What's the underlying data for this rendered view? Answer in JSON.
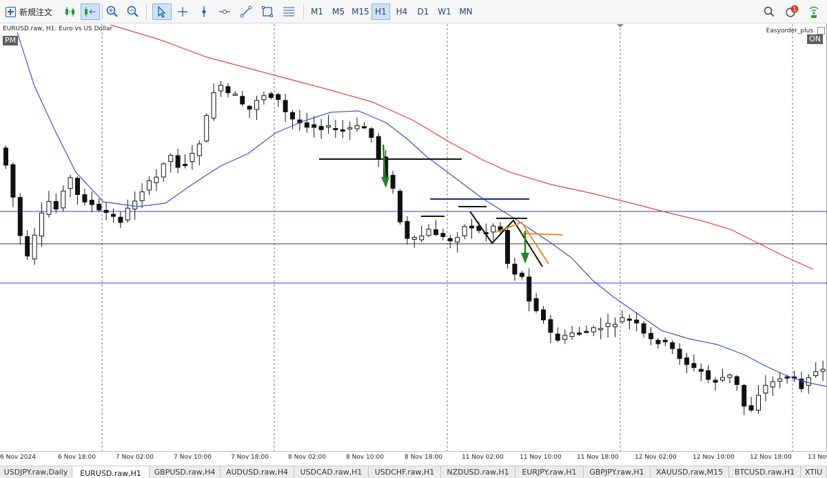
{
  "toolbar": {
    "new_order_label": "新規注文",
    "timeframes": [
      "M1",
      "M5",
      "M15",
      "H1",
      "H4",
      "D1",
      "W1",
      "MN"
    ],
    "active_timeframe": "H1",
    "notification_count": "1",
    "icons": [
      "algo-trading-icon",
      "one-click-trading-icon",
      "zoom-in-icon",
      "zoom-out-icon",
      "cursor-icon",
      "crosshair-icon",
      "vertical-line-icon",
      "horizontal-line-icon",
      "trendline-icon",
      "shapes-icon",
      "fibonacci-icon",
      "search-icon",
      "notifications-icon",
      "signals-icon"
    ]
  },
  "chart": {
    "symbol_title": "EURUSD.raw, H1:  Euro vs US Dollar",
    "pm_label": "PM",
    "ea_name": "Easyorder_plus",
    "ea_state": "ON",
    "colors": {
      "ma_slow": "#e0443c",
      "ma_fast": "#3d4fd0",
      "level_line": "#3a3ae0",
      "arrow": "#1f8a1f",
      "orange_line": "#f08a1c"
    },
    "time_labels": [
      "6 Nov 2024",
      "6 Nov 18:00",
      "7 Nov 02:00",
      "7 Nov 10:00",
      "7 Nov 18:00",
      "8 Nov 02:00",
      "8 Nov 10:00",
      "8 Nov 18:00",
      "11 Nov 02:00",
      "11 Nov 10:00",
      "11 Nov 18:00",
      "12 Nov 02:00",
      "12 Nov 10:00",
      "12 Nov 18:00",
      "13 Nov"
    ]
  },
  "tabs": {
    "items": [
      "USDJPY.raw,Daily",
      "EURUSD.raw,H1",
      "GBPUSD.raw,H4",
      "AUDUSD.raw,H4",
      "USDCAD.raw,H1",
      "USDCHF.raw,H1",
      "NZDUSD.raw,H1",
      "EURJPY.raw,H1",
      "GBPJPY.raw,H1",
      "XAUUSD.raw,M15",
      "BTCUSD.raw,H1",
      "XTIU"
    ],
    "active_index": 1
  }
}
